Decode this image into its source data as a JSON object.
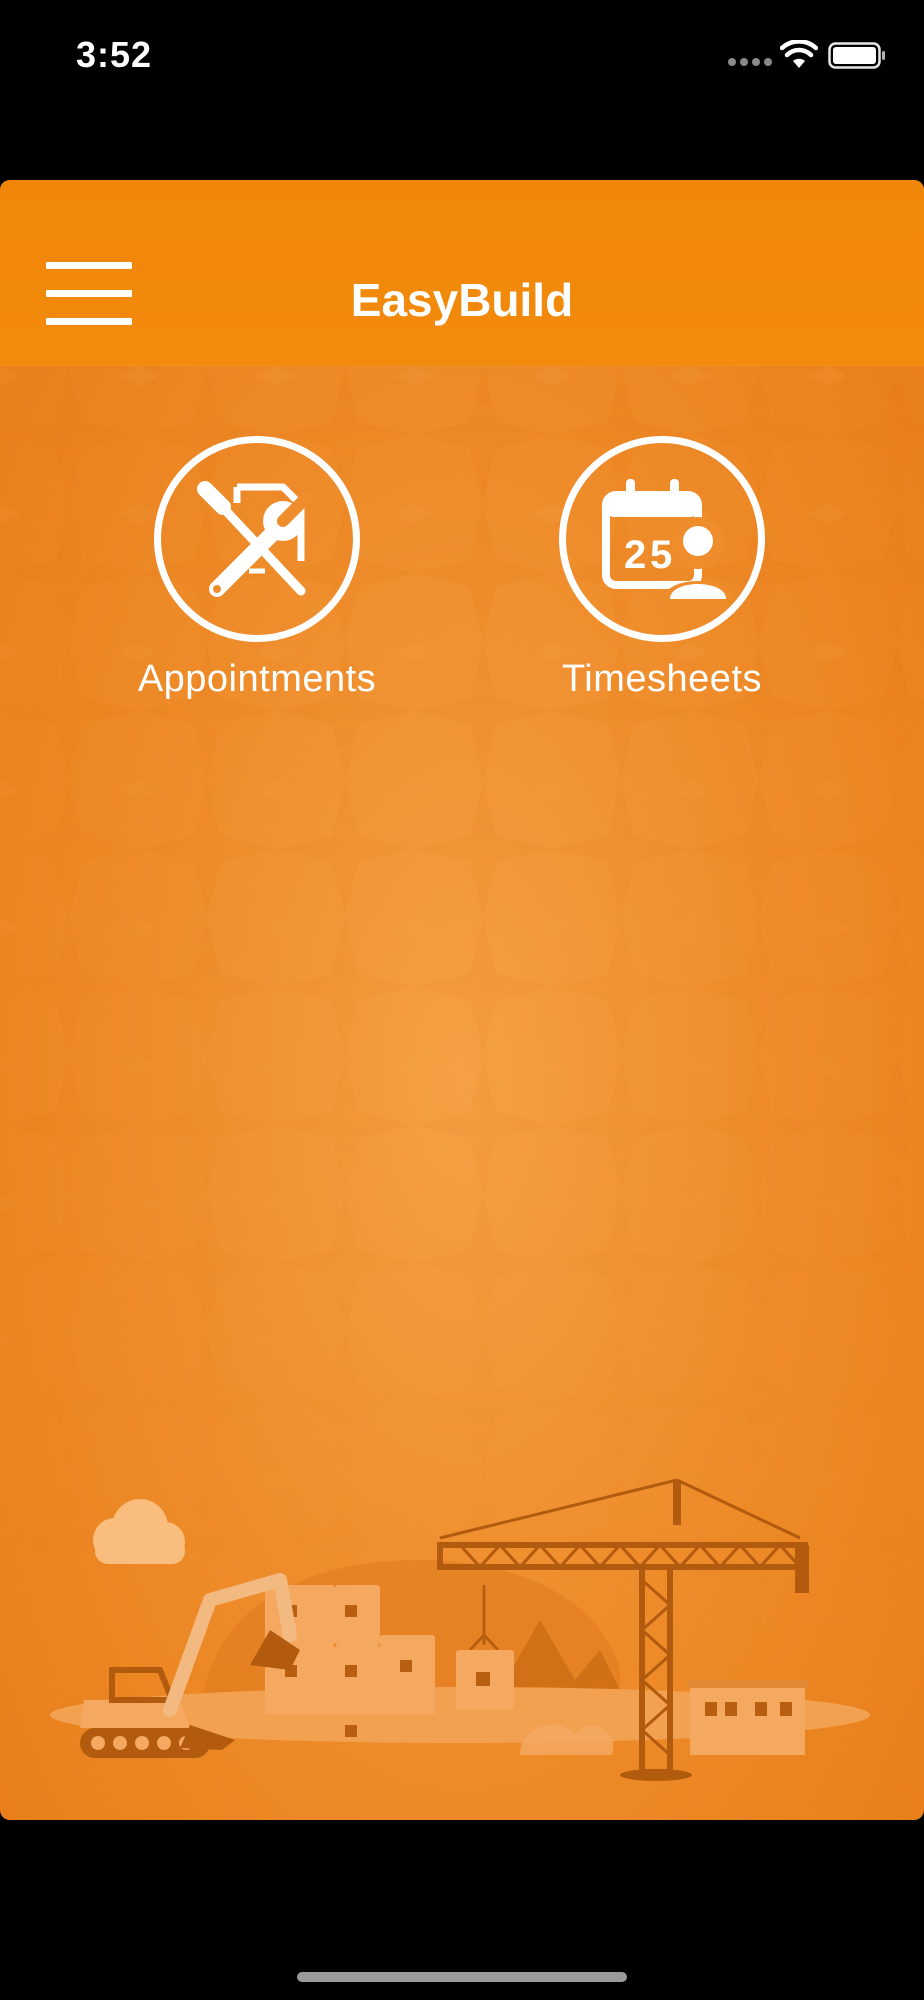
{
  "status_bar": {
    "time": "3:52",
    "icons": [
      "signal-dots-icon",
      "wifi-icon",
      "battery-icon"
    ]
  },
  "header": {
    "title": "EasyBuild",
    "menu_icon": "hamburger-menu-icon"
  },
  "tiles": [
    {
      "label": "Appointments",
      "icon": "wrench-screwdriver-icon"
    },
    {
      "label": "Timesheets",
      "icon": "calendar-person-icon"
    }
  ],
  "background": {
    "illustration": "construction-site-illustration",
    "colors": {
      "header": "#f0870a",
      "body": "#ef8d2c",
      "text": "#ffffff"
    }
  }
}
